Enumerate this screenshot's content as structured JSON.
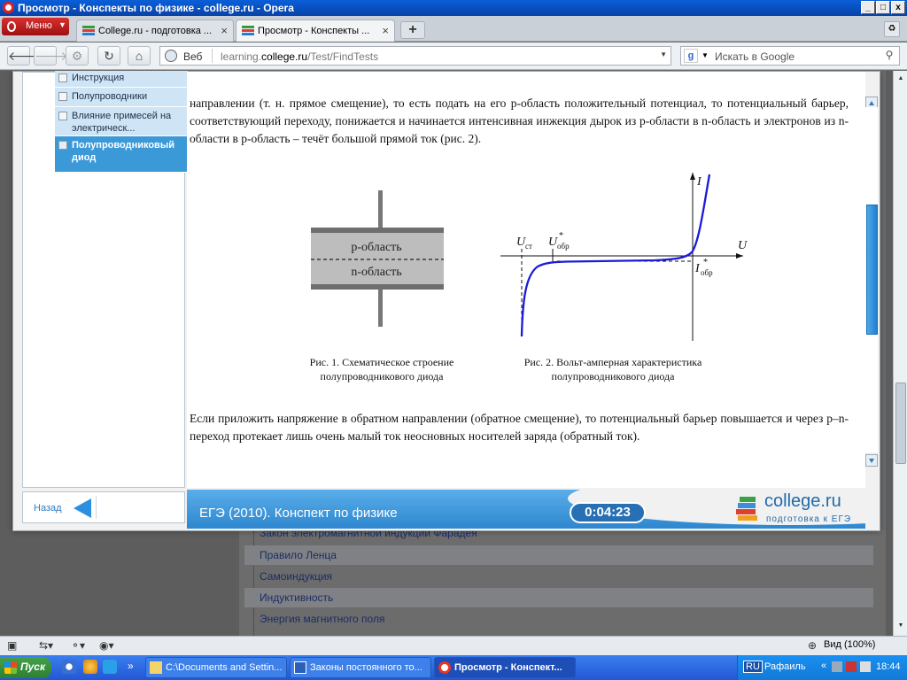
{
  "window": {
    "title": "Просмотр - Конспекты по физике - college.ru - Opera",
    "buttons": [
      "_",
      "□",
      "x"
    ]
  },
  "tabs": {
    "menu_label": "Меню",
    "items": [
      {
        "label": "College.ru - подготовка ..."
      },
      {
        "label": "Просмотр - Конспекты ..."
      }
    ],
    "new_tab": "+"
  },
  "address": {
    "web_label": "Веб",
    "url_prefix": "learning.",
    "url_domain": "college.ru",
    "url_path": "/Test/FindTests",
    "search_placeholder": "Искать в Google"
  },
  "sidebar": {
    "items": [
      {
        "label": "Инструкция",
        "active": false
      },
      {
        "label": "Полупроводники",
        "active": false
      },
      {
        "label": "Влияние примесей на электрическ...",
        "active": false
      },
      {
        "label": "Полупроводниковый диод",
        "active": true
      }
    ],
    "back_label": "Назад"
  },
  "content": {
    "para1": "направлении (т. н. прямое смещение), то есть подать на его p-область положительный потенциал, то потенциальный барьер, соответствующий переходу, понижается и начинается интенсивная инжекция дырок из p-области в n-область и электронов из n-области в p-область – течёт большой прямой ток (рис. 2).",
    "fig1": {
      "p_label": "p-область",
      "n_label": "n-область",
      "caption_line1": "Рис. 1. Схематическое строение",
      "caption_line2": "полупроводникового диода"
    },
    "fig2": {
      "axis_i": "I",
      "axis_u": "U",
      "u_st": "U",
      "u_st_sub": "ст",
      "u_obr": "U",
      "u_obr_sub": "обр",
      "u_obr_sup": "*",
      "i_obr": "I",
      "i_obr_sub": "обр",
      "i_obr_sup": "*",
      "caption_line1": "Рис. 2. Вольт-амперная характеристика",
      "caption_line2": "полупроводникового диода"
    },
    "para2": "Если приложить напряжение в обратном направлении (обратное смещение), то потенциальный барьер повышается и через p–n-переход протекает лишь очень малый ток неосновных носителей заряда (обратный ток)."
  },
  "footer": {
    "title": "ЕГЭ (2010). Конспект по физике",
    "timer": "0:04:23",
    "logo_name": "college.ru",
    "logo_tag": "подготовка к ЕГЭ"
  },
  "underlying_list": [
    "Закон электромагнитной индукции Фарадея",
    "Правило Ленца",
    "Самоиндукция",
    "Индуктивность",
    "Энергия магнитного поля"
  ],
  "statusbar": {
    "zoom": "Вид (100%)"
  },
  "taskbar": {
    "start": "Пуск",
    "more": "»",
    "buttons": [
      {
        "label": "C:\\Documents and Settin...",
        "active": false
      },
      {
        "label": "Законы постоянного то...",
        "active": false
      },
      {
        "label": "Просмотр - Конспект...",
        "active": true
      }
    ],
    "lang": "RU",
    "user": "Рафаиль",
    "tray_more": "«",
    "time": "18:44"
  },
  "colors": {
    "accent": "#3b99d8",
    "curve": "#1b1bd8"
  }
}
